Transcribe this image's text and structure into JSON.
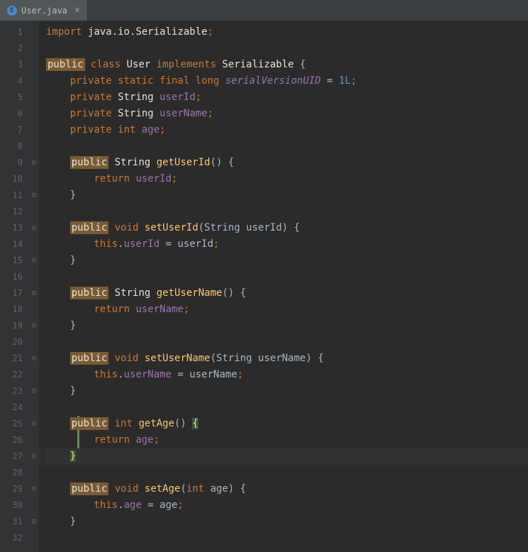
{
  "tab": {
    "icon_letter": "C",
    "label": "User.java",
    "close": "×"
  },
  "line_count": 32,
  "current_line": 27,
  "change_marker": {
    "start": 25,
    "end": 27
  },
  "fold_marks": {
    "9": "⊟",
    "11": "⊟",
    "13": "⊟",
    "15": "⊟",
    "17": "⊟",
    "19": "⊟",
    "21": "⊟",
    "23": "⊟",
    "25": "⊟",
    "27": "⊟",
    "29": "⊟",
    "31": "⊟"
  },
  "code": [
    [
      {
        "t": "import ",
        "c": "kw"
      },
      {
        "t": "java.io.Serializable",
        "c": "cls"
      },
      {
        "t": ";",
        "c": "punct"
      }
    ],
    [],
    [
      {
        "t": "public",
        "c": "kw-hl"
      },
      {
        "t": " ",
        "c": ""
      },
      {
        "t": "class ",
        "c": "kw"
      },
      {
        "t": "User ",
        "c": "cls"
      },
      {
        "t": "implements ",
        "c": "kw"
      },
      {
        "t": "Serializable ",
        "c": "cls"
      },
      {
        "t": "{",
        "c": "punct-w"
      }
    ],
    [
      {
        "t": "    ",
        "c": ""
      },
      {
        "t": "private static final long",
        "c": "kw"
      },
      {
        "t": " ",
        "c": ""
      },
      {
        "t": "serialVersionUID",
        "c": "static-field"
      },
      {
        "t": " = ",
        "c": "punct-w"
      },
      {
        "t": "1L",
        "c": "num"
      },
      {
        "t": ";",
        "c": "punct"
      }
    ],
    [
      {
        "t": "    ",
        "c": ""
      },
      {
        "t": "private",
        "c": "kw"
      },
      {
        "t": " String ",
        "c": "str-type"
      },
      {
        "t": "userId",
        "c": "field"
      },
      {
        "t": ";",
        "c": "punct"
      }
    ],
    [
      {
        "t": "    ",
        "c": ""
      },
      {
        "t": "private",
        "c": "kw"
      },
      {
        "t": " String ",
        "c": "str-type"
      },
      {
        "t": "userName",
        "c": "field"
      },
      {
        "t": ";",
        "c": "punct"
      }
    ],
    [
      {
        "t": "    ",
        "c": ""
      },
      {
        "t": "private int",
        "c": "kw"
      },
      {
        "t": " ",
        "c": ""
      },
      {
        "t": "age",
        "c": "field"
      },
      {
        "t": ";",
        "c": "punct"
      }
    ],
    [],
    [
      {
        "t": "    ",
        "c": ""
      },
      {
        "t": "public",
        "c": "kw-hl"
      },
      {
        "t": " String ",
        "c": "str-type"
      },
      {
        "t": "getUserId",
        "c": "method-decl"
      },
      {
        "t": "() {",
        "c": "punct-w"
      }
    ],
    [
      {
        "t": "        ",
        "c": ""
      },
      {
        "t": "return",
        "c": "kw"
      },
      {
        "t": " ",
        "c": ""
      },
      {
        "t": "userId",
        "c": "field"
      },
      {
        "t": ";",
        "c": "punct"
      }
    ],
    [
      {
        "t": "    }",
        "c": "punct-w"
      }
    ],
    [],
    [
      {
        "t": "    ",
        "c": ""
      },
      {
        "t": "public",
        "c": "kw-hl"
      },
      {
        "t": " ",
        "c": ""
      },
      {
        "t": "void",
        "c": "kw"
      },
      {
        "t": " ",
        "c": ""
      },
      {
        "t": "setUserId",
        "c": "method-decl"
      },
      {
        "t": "(String userId) {",
        "c": "punct-w"
      }
    ],
    [
      {
        "t": "        ",
        "c": ""
      },
      {
        "t": "this",
        "c": "this-kw"
      },
      {
        "t": ".",
        "c": "punct-w"
      },
      {
        "t": "userId",
        "c": "field"
      },
      {
        "t": " = userId",
        "c": "punct-w"
      },
      {
        "t": ";",
        "c": "punct"
      }
    ],
    [
      {
        "t": "    }",
        "c": "punct-w"
      }
    ],
    [],
    [
      {
        "t": "    ",
        "c": ""
      },
      {
        "t": "public",
        "c": "kw-hl"
      },
      {
        "t": " String ",
        "c": "str-type"
      },
      {
        "t": "getUserName",
        "c": "method-decl"
      },
      {
        "t": "() {",
        "c": "punct-w"
      }
    ],
    [
      {
        "t": "        ",
        "c": ""
      },
      {
        "t": "return",
        "c": "kw"
      },
      {
        "t": " ",
        "c": ""
      },
      {
        "t": "userName",
        "c": "field"
      },
      {
        "t": ";",
        "c": "punct"
      }
    ],
    [
      {
        "t": "    }",
        "c": "punct-w"
      }
    ],
    [],
    [
      {
        "t": "    ",
        "c": ""
      },
      {
        "t": "public",
        "c": "kw-hl"
      },
      {
        "t": " ",
        "c": ""
      },
      {
        "t": "void",
        "c": "kw"
      },
      {
        "t": " ",
        "c": ""
      },
      {
        "t": "setUserName",
        "c": "method-decl"
      },
      {
        "t": "(String userName) {",
        "c": "punct-w"
      }
    ],
    [
      {
        "t": "        ",
        "c": ""
      },
      {
        "t": "this",
        "c": "this-kw"
      },
      {
        "t": ".",
        "c": "punct-w"
      },
      {
        "t": "userName",
        "c": "field"
      },
      {
        "t": " = userName",
        "c": "punct-w"
      },
      {
        "t": ";",
        "c": "punct"
      }
    ],
    [
      {
        "t": "    }",
        "c": "punct-w"
      }
    ],
    [],
    [
      {
        "t": "    ",
        "c": ""
      },
      {
        "t": "public",
        "c": "kw-hl"
      },
      {
        "t": " ",
        "c": ""
      },
      {
        "t": "int",
        "c": "kw"
      },
      {
        "t": " ",
        "c": ""
      },
      {
        "t": "getAge",
        "c": "method-decl"
      },
      {
        "t": "() ",
        "c": "punct-w"
      },
      {
        "t": "{",
        "c": "brace-hl"
      }
    ],
    [
      {
        "t": "        ",
        "c": ""
      },
      {
        "t": "return",
        "c": "kw"
      },
      {
        "t": " ",
        "c": ""
      },
      {
        "t": "age",
        "c": "field"
      },
      {
        "t": ";",
        "c": "punct"
      }
    ],
    [
      {
        "t": "    ",
        "c": ""
      },
      {
        "t": "}",
        "c": "brace-hl"
      }
    ],
    [],
    [
      {
        "t": "    ",
        "c": ""
      },
      {
        "t": "public",
        "c": "kw-hl"
      },
      {
        "t": " ",
        "c": ""
      },
      {
        "t": "void",
        "c": "kw"
      },
      {
        "t": " ",
        "c": ""
      },
      {
        "t": "setAge",
        "c": "method-decl"
      },
      {
        "t": "(",
        "c": "punct-w"
      },
      {
        "t": "int",
        "c": "kw"
      },
      {
        "t": " age) {",
        "c": "punct-w"
      }
    ],
    [
      {
        "t": "        ",
        "c": ""
      },
      {
        "t": "this",
        "c": "this-kw"
      },
      {
        "t": ".",
        "c": "punct-w"
      },
      {
        "t": "age",
        "c": "field"
      },
      {
        "t": " = age",
        "c": "punct-w"
      },
      {
        "t": ";",
        "c": "punct"
      }
    ],
    [
      {
        "t": "    }",
        "c": "punct-w"
      }
    ],
    []
  ]
}
